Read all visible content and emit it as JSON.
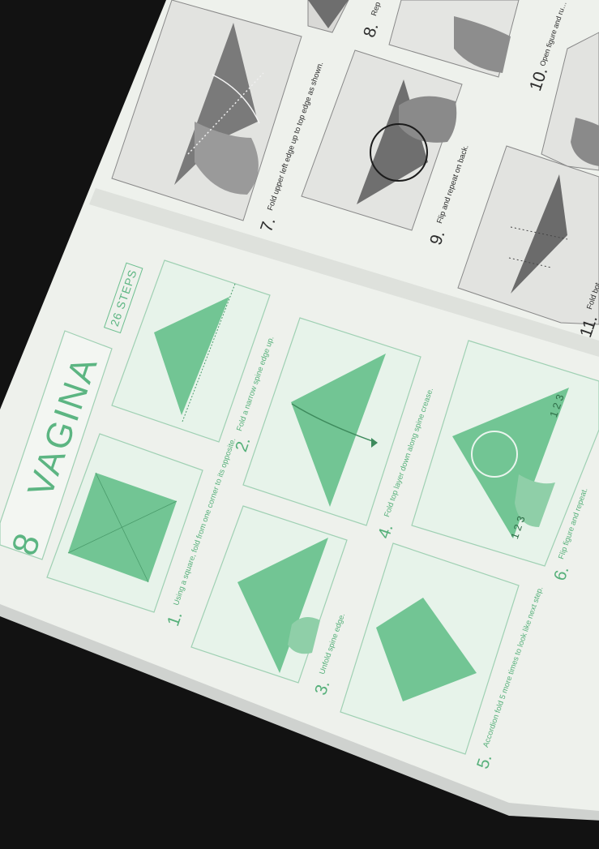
{
  "page": {
    "number": "8",
    "title": "VAGINA",
    "steps_badge": "26 STEPS"
  },
  "colors": {
    "background": "#121212",
    "paper": "#eef1ec",
    "accent_green": "#5cb582",
    "gray_photo": "#8a8a8a"
  },
  "steps_green": [
    {
      "num": "1.",
      "caption": "Using a square, fold from one corner to its opposite."
    },
    {
      "num": "2.",
      "caption": "Fold a narrow spine edge up."
    },
    {
      "num": "3.",
      "caption": "Unfold spine edge."
    },
    {
      "num": "4.",
      "caption": "Fold top layer down along spine crease."
    },
    {
      "num": "5.",
      "caption": "Accordion fold 5 more times to look like next step."
    },
    {
      "num": "6.",
      "caption": "Flip figure and repeat."
    }
  ],
  "step6_markers": {
    "top": "1 2 3",
    "bottom": "1 2 3"
  },
  "steps_gray": [
    {
      "num": "7.",
      "caption": "Fold upper left edge up to top edge as shown."
    },
    {
      "num": "8.",
      "caption": "Rep"
    },
    {
      "num": "9.",
      "caption": "Flip and repeat on back."
    },
    {
      "num": "10.",
      "caption": "Open figure and ru… See next step for o…"
    },
    {
      "num": "11.",
      "caption": "Fold bot…"
    }
  ]
}
